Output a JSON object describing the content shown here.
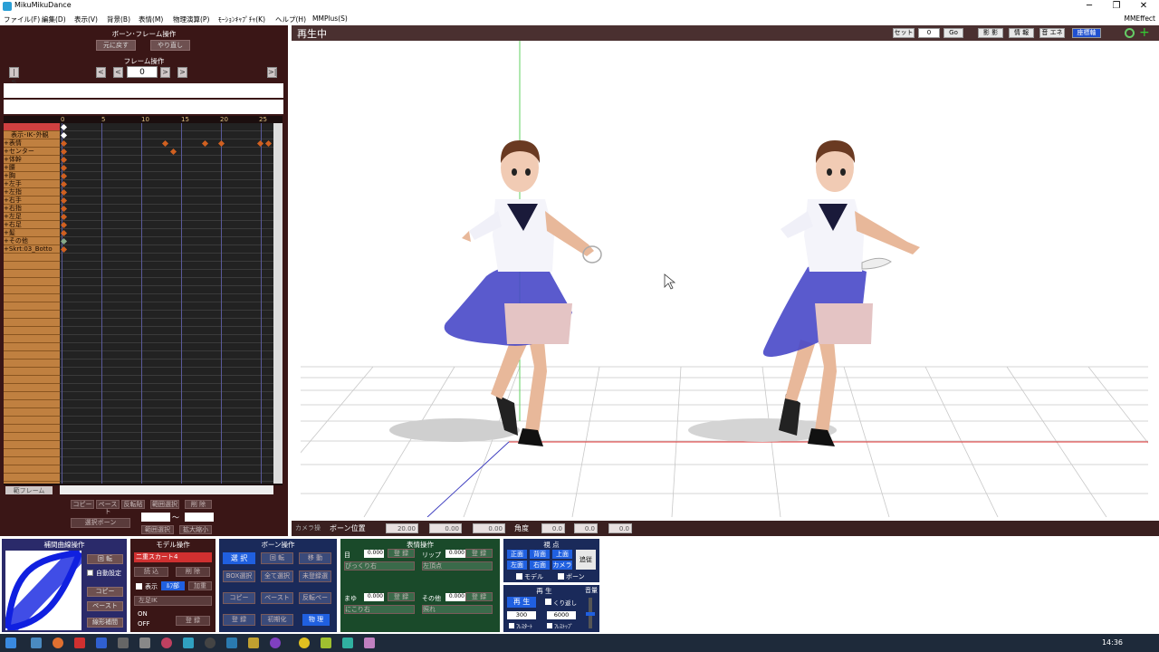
{
  "window": {
    "title": "MikuMikuDance",
    "minimize": "─",
    "maximize": "❐",
    "close": "✕"
  },
  "menu": {
    "items": [
      "ファイル(F)",
      "編集(D)",
      "表示(V)",
      "背景(B)",
      "表情(M)",
      "物理演算(P)",
      "ﾓｰｼｮﾝｷｬﾌﾟﾁｬ(K)",
      "ヘルプ(H)",
      "MMPlus(S)"
    ],
    "right": "MMEffect"
  },
  "bone_frame": {
    "title": "ボーン･フレーム操作",
    "undo": "元に戻す",
    "redo": "やり直し"
  },
  "frame_ops": {
    "title": "フレーム操作",
    "frame_number": "0",
    "first": "|<",
    "prev_key": "<",
    "prev": "<",
    "next": ">",
    "next_key": ">",
    "last": ">|"
  },
  "timeline": {
    "frame_ticks": [
      "0",
      "5",
      "10",
      "15",
      "20",
      "25"
    ],
    "bones": [
      "",
      "表示･IK･外観",
      "+表情",
      "+センター",
      "+体幹",
      "+腰",
      "+胸",
      "+左手",
      "+左指",
      "+右手",
      "+右指",
      "+左足",
      "+右足",
      "+髪",
      "+その他",
      "+Skrt:03_Botto"
    ]
  },
  "timeline_controls": {
    "select_frame": "範フレーム",
    "copy": "コピー",
    "paste": "ペースト",
    "reverse": "反転貼",
    "range_copy": "範囲選択",
    "delete": "削 除",
    "select_bone": "選択ボーン",
    "range_select": "範囲選択",
    "expand": "拡大縮小",
    "tilde": "～"
  },
  "viewport": {
    "status": "再生中",
    "set_label": "セット",
    "frame_value": "0",
    "go_label": "Go",
    "shadow": "影 影",
    "info": "情 報",
    "sound": "音 エネ",
    "axis": "座標軸"
  },
  "bone_position": {
    "camera": "カメラ操",
    "label": "ボーン位置",
    "x": "20.00",
    "y": "0.00",
    "z": "0.00",
    "angle_label": "角度",
    "ax": "0.0",
    "ay": "0.0",
    "az": "0.0"
  },
  "interp": {
    "title": "補間曲線操作",
    "rotate": "回 転",
    "auto": "自動設定",
    "copy": "コピー",
    "paste": "ペースト",
    "linear": "線形補間"
  },
  "model_ops": {
    "title": "モデル操作",
    "model_name": "二重スカート4",
    "load": "読 込",
    "delete": "削 除",
    "display": "表示",
    "half": "ﾙﾌ部",
    "add": "加重",
    "target": "左足IK",
    "on": "ON",
    "off": "OFF",
    "register": "登 録"
  },
  "bone_ops": {
    "title": "ボーン操作",
    "select": "選 択",
    "rotate": "回 転",
    "move": "移 動",
    "box": "BOX選択",
    "select_all": "全て選択",
    "unregistered": "未登録選",
    "copy": "コピー",
    "paste": "ペースト",
    "reverse": "反転ペー",
    "register": "登 録",
    "init": "初期化",
    "physics": "物 理"
  },
  "expression": {
    "title": "表情操作",
    "eye": "目",
    "eye_val": "0.000",
    "lip": "リップ",
    "lip_val": "0.000",
    "eye_sel": "びっくり右",
    "lip_sel": "左頂点",
    "brow": "まゆ",
    "brow_val": "0.000",
    "other": "その他",
    "other_val": "0.000",
    "brow_sel": "にこり右",
    "other_sel": "照れ",
    "register": "登 録"
  },
  "view": {
    "title": "視 点",
    "front": "正面",
    "back": "背面",
    "top": "上面",
    "left": "左面",
    "right": "右面",
    "camera": "カメラ",
    "track": "追従",
    "model": "モデル",
    "bone": "ボーン"
  },
  "playback": {
    "title": "再 生",
    "play": "再 生",
    "repeat": "くり返し",
    "from": "300",
    "to": "6000",
    "start": "ﾌﾚｽﾀｰﾄ",
    "stop": "ﾌﾚｽﾄｯﾌﾟ",
    "volume": "音量"
  },
  "taskbar": {
    "time": "14:36"
  },
  "colors": {
    "panel": "#3a1616",
    "accent_red": "#d04040",
    "bone_list": "#c08040",
    "viewport_header": "#4a3030"
  }
}
